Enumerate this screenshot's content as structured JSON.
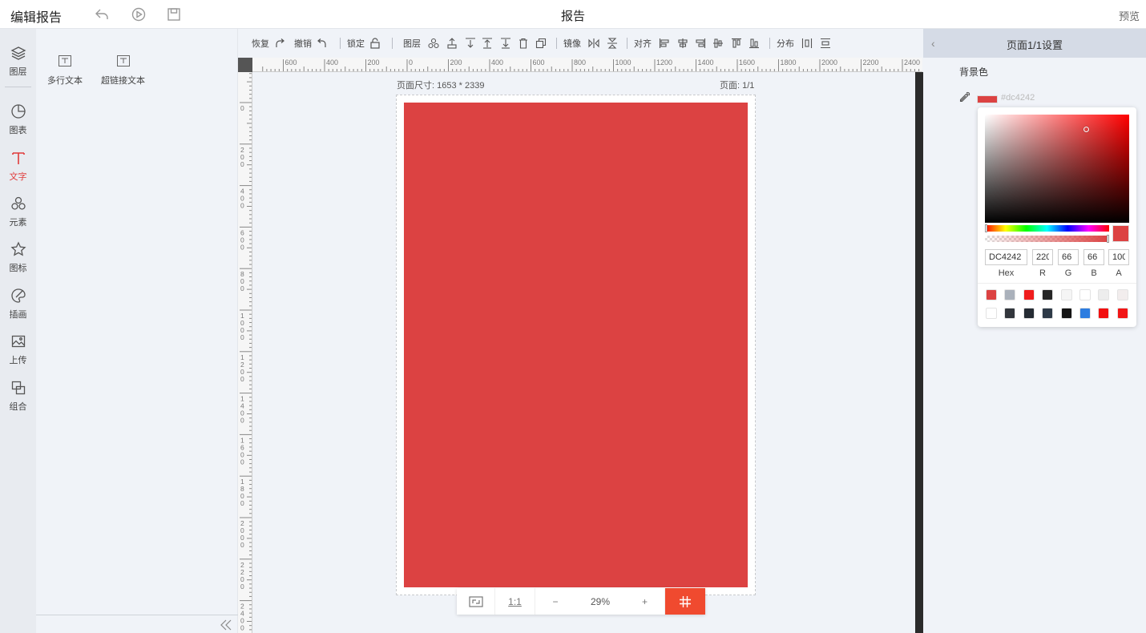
{
  "header": {
    "app_title": "编辑报告",
    "doc_title": "报告",
    "preview_label": "预览",
    "icons": [
      "undo-icon",
      "play-icon",
      "save-icon"
    ]
  },
  "sidebar": {
    "items": [
      {
        "label": "图层",
        "icon": "layers-icon"
      },
      {
        "label": "图表",
        "icon": "pie-chart-icon"
      },
      {
        "label": "文字",
        "icon": "text-icon",
        "active": true
      },
      {
        "label": "元素",
        "icon": "shapes-icon"
      },
      {
        "label": "图标",
        "icon": "star-icon"
      },
      {
        "label": "插画",
        "icon": "palette-icon"
      },
      {
        "label": "上传",
        "icon": "upload-image-icon"
      },
      {
        "label": "组合",
        "icon": "group-icon"
      }
    ]
  },
  "left_panel": {
    "tools": [
      {
        "label": "多行文本",
        "icon": "textbox-icon"
      },
      {
        "label": "超链接文本",
        "icon": "link-text-icon"
      }
    ]
  },
  "toolbar": {
    "redo_label": "恢复",
    "undo_label": "撤销",
    "lock_label": "锁定",
    "layer_label": "图层",
    "mirror_label": "镜像",
    "align_label": "对齐",
    "distribute_label": "分布"
  },
  "ruler": {
    "h_labels": [
      "600",
      "400",
      "200",
      "0",
      "200",
      "400",
      "600",
      "800",
      "1000",
      "1200",
      "1400",
      "1600",
      "1800",
      "2000",
      "2200",
      "2400"
    ],
    "v_labels": [
      "0",
      "200",
      "400",
      "600",
      "800",
      "1000",
      "1200",
      "1400",
      "1600",
      "1800",
      "2000",
      "2200",
      "2400"
    ]
  },
  "canvas": {
    "page_size": "页面尺寸: 1653 * 2339",
    "page_number": "页面: 1/1",
    "page_color": "#dc4242"
  },
  "zoom": {
    "fit_icon": "fit-screen-icon",
    "one_to_one": "1:1",
    "minus": "−",
    "value": "29%",
    "plus": "+",
    "grid_icon": "grid-icon"
  },
  "right_panel": {
    "back_icon": "chevron-left-icon",
    "title": "页面1/1设置",
    "bg_label": "背景色",
    "bg_hex": "#dc4242",
    "picker": {
      "hex": "DC4242",
      "r": "220",
      "g": "66",
      "b": "66",
      "a": "100",
      "hex_label": "Hex",
      "r_label": "R",
      "g_label": "G",
      "b_label": "B",
      "a_label": "A",
      "hue_fraction": 0,
      "saturation": 0.7,
      "value": 0.86,
      "alpha_fraction": 1.0,
      "presets": [
        "#dc4242",
        "#aab1bb",
        "#f01d1d",
        "#262626",
        "#f5f5f5",
        "#ffffff",
        "#ededed",
        "#f2eded",
        "#ffffff",
        "#32363c",
        "#252b33",
        "#2e3a47",
        "#141414",
        "#2d7de0",
        "#f20f0f",
        "#f21616"
      ]
    }
  },
  "colors": {
    "accent": "#e03b3b",
    "zoom_grid_bg": "#f04a2f"
  }
}
